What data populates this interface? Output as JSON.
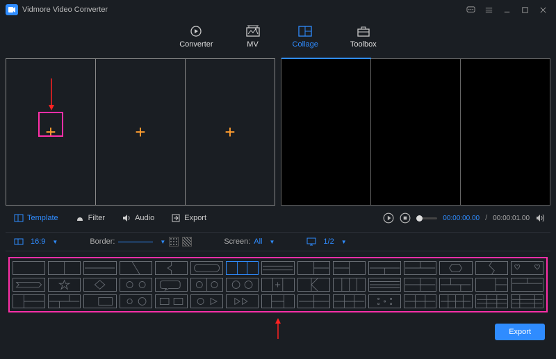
{
  "app": {
    "title": "Vidmore Video Converter"
  },
  "nav": {
    "converter": "Converter",
    "mv": "MV",
    "collage": "Collage",
    "toolbox": "Toolbox"
  },
  "tabs": {
    "template": "Template",
    "filter": "Filter",
    "audio": "Audio",
    "export": "Export"
  },
  "playback": {
    "current": "00:00:00.00",
    "total": "00:00:01.00"
  },
  "options": {
    "aspect": "16:9",
    "border_label": "Border:",
    "screen_label": "Screen:",
    "screen_value": "All",
    "ratio_value": "1/2"
  },
  "actions": {
    "export": "Export"
  },
  "colors": {
    "accent": "#2f8cff",
    "highlight": "#ff2fa8",
    "plus": "#ff9d2f"
  }
}
